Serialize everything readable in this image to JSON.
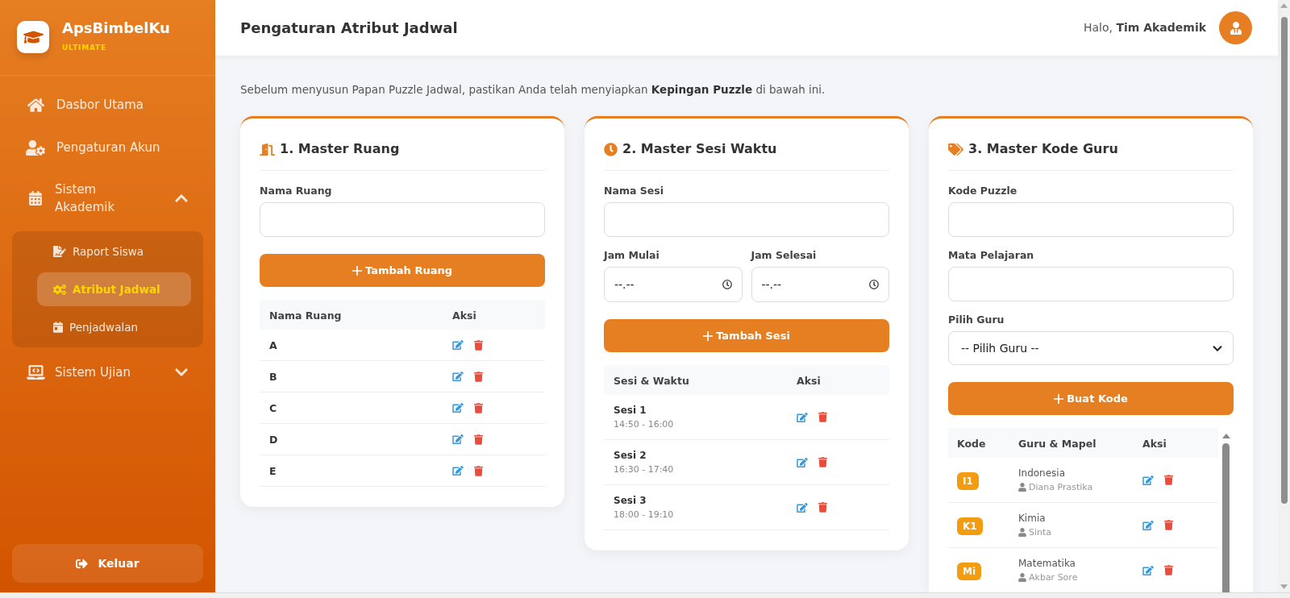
{
  "sidebar": {
    "brand": {
      "name": "ApsBimbelKu",
      "tier": "ULTIMATE"
    },
    "menu": [
      {
        "kind": "link",
        "label": "Dasbor Utama",
        "selected": false
      },
      {
        "kind": "link",
        "label": "Pengaturan Akun",
        "selected": false
      },
      {
        "kind": "group",
        "label": "Sistem Akademik",
        "expanded": true,
        "children": [
          {
            "label": "Raport Siswa",
            "selected": false
          },
          {
            "label": "Atribut Jadwal",
            "selected": true
          },
          {
            "label": "Penjadwalan",
            "selected": false
          }
        ]
      },
      {
        "kind": "group",
        "label": "Sistem Ujian",
        "expanded": false
      }
    ],
    "logout": "Keluar"
  },
  "header": {
    "title": "Pengaturan Atribut Jadwal",
    "greeting": "Halo, **Tim Akademik**"
  },
  "intro": "Sebelum menyusun Papan Puzzle Jadwal, pastikan Anda telah menyiapkan **Kepingan Puzzle** di bawah ini.",
  "cards": [
    {
      "kind": "room",
      "title": "1. Master Ruang",
      "fields": [
        {
          "kind": "text",
          "label": "Nama Ruang"
        }
      ],
      "button": "Tambah Ruang",
      "table": {
        "columns": [
          "Nama Ruang",
          "Aksi"
        ],
        "rows": [
          {
            "name": "A"
          },
          {
            "name": "B"
          },
          {
            "name": "C"
          },
          {
            "name": "D"
          },
          {
            "name": "E"
          }
        ]
      }
    },
    {
      "kind": "session",
      "title": "2. Master Sesi Waktu",
      "fields": [
        {
          "kind": "text",
          "label": "Nama Sesi"
        },
        {
          "kind": "time",
          "label": "Jam Mulai",
          "placeholder": "--.--"
        },
        {
          "kind": "time",
          "label": "Jam Selesai",
          "placeholder": "--.--"
        }
      ],
      "button": "Tambah Sesi",
      "table": {
        "columns": [
          "Sesi & Waktu",
          "Aksi"
        ],
        "rows": [
          {
            "name": "Sesi 1",
            "time": "14:50 - 16:00"
          },
          {
            "name": "Sesi 2",
            "time": "16:30 - 17:40"
          },
          {
            "name": "Sesi 3",
            "time": "18:00 - 19:10"
          }
        ]
      }
    },
    {
      "kind": "teacher_code",
      "title": "3. Master Kode Guru",
      "fields": [
        {
          "kind": "text",
          "label": "Kode Puzzle"
        },
        {
          "kind": "text",
          "label": "Mata Pelajaran"
        },
        {
          "kind": "select",
          "label": "Pilih Guru",
          "value": "-- Pilih Guru --"
        }
      ],
      "button": "Buat Kode",
      "table": {
        "columns": [
          "Kode",
          "Guru & Mapel",
          "Aksi"
        ],
        "rows": [
          {
            "code": "I1",
            "subject": "Indonesia",
            "teacher": "Diana Prastika"
          },
          {
            "code": "K1",
            "subject": "Kimia",
            "teacher": "Sinta"
          },
          {
            "code": "Mi",
            "subject": "Matematika",
            "teacher": "Akbar Sore"
          }
        ]
      }
    }
  ]
}
